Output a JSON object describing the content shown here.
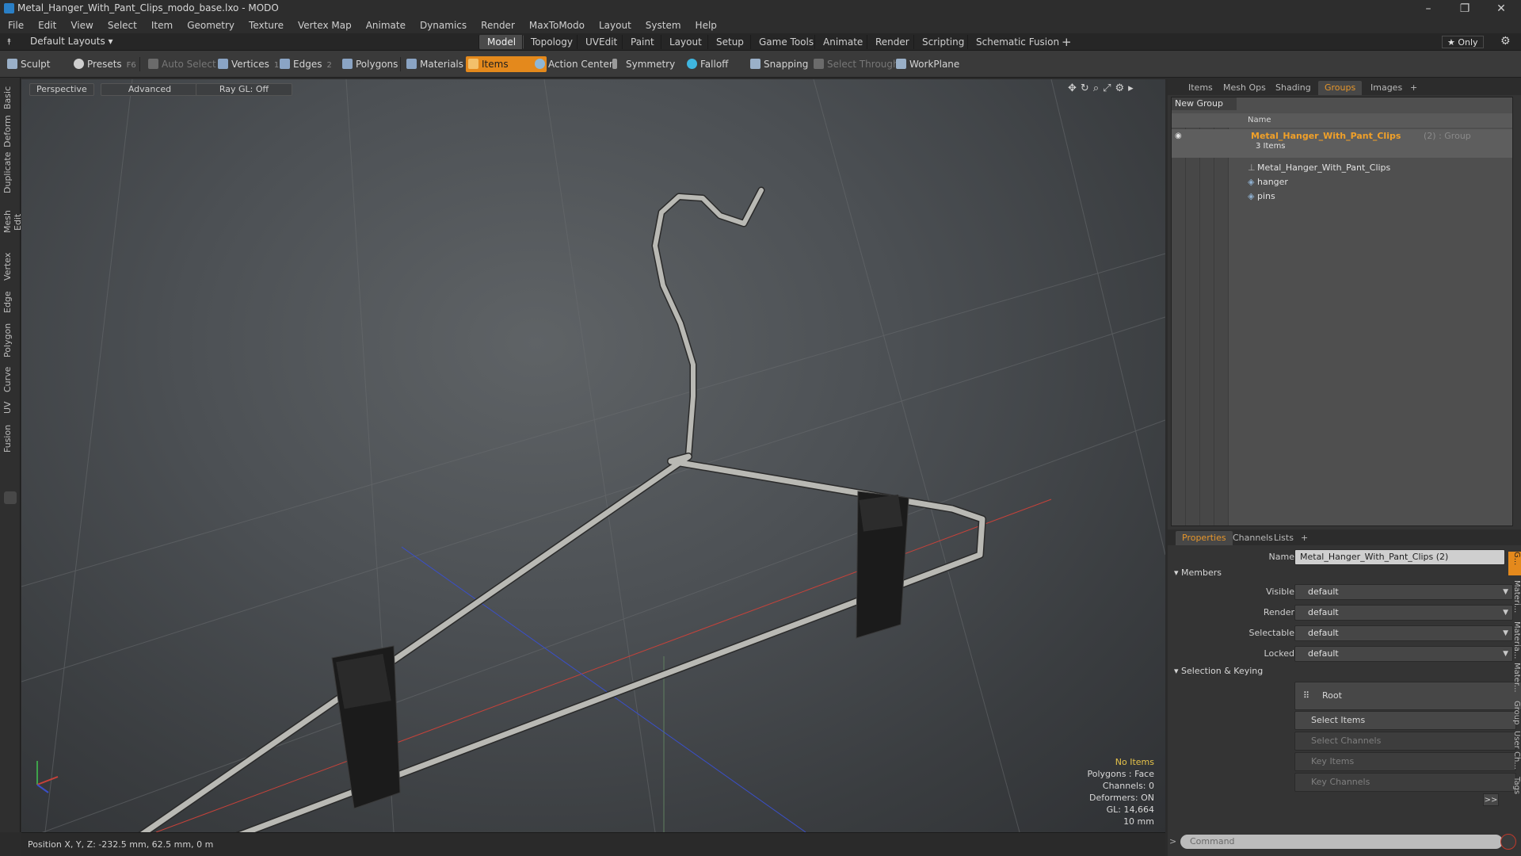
{
  "window": {
    "title": "Metal_Hanger_With_Pant_Clips_modo_base.lxo - MODO",
    "minimize": "–",
    "restore": "❐",
    "close": "✕"
  },
  "menu": [
    "File",
    "Edit",
    "View",
    "Select",
    "Item",
    "Geometry",
    "Texture",
    "Vertex Map",
    "Animate",
    "Dynamics",
    "Render",
    "MaxToModo",
    "Layout",
    "System",
    "Help"
  ],
  "layouts": {
    "dropdown": "Default Layouts ▾",
    "tabs": [
      "Model",
      "Topology",
      "UVEdit",
      "Paint",
      "Layout",
      "Setup",
      "Game Tools",
      "Animate",
      "Render",
      "Scripting",
      "Schematic Fusion"
    ],
    "active": "Model",
    "plus": "+",
    "only": "★  Only",
    "gear": "⚙"
  },
  "toolbar": {
    "sculpt": "Sculpt",
    "presets": "Presets",
    "presets_key": "F6",
    "auto_select": "Auto Select",
    "vertices": "Vertices",
    "vertices_count": "1",
    "edges": "Edges",
    "edges_count": "2",
    "polygons": "Polygons",
    "materials": "Materials",
    "items": "Items",
    "action_center": "Action Center",
    "symmetry": "Symmetry",
    "falloff": "Falloff",
    "snapping": "Snapping",
    "select_through": "Select Through",
    "workplane": "WorkPlane"
  },
  "left_tabs": [
    "Basic",
    "Deform",
    "Duplicate",
    "Mesh Edit",
    "Vertex",
    "Edge",
    "Polygon",
    "Curve",
    "UV",
    "Fusion"
  ],
  "viewport": {
    "perspective": "Perspective",
    "advanced": "Advanced",
    "raygl": "Ray GL: Off",
    "info": {
      "items": "No Items",
      "polygons": "Polygons : Face",
      "channels": "Channels: 0",
      "deformers": "Deformers: ON",
      "gl": "GL: 14,664",
      "scale": "10 mm"
    },
    "colors": {
      "wire": "#b9b9b4",
      "clip": "#1c1c1c",
      "x_axis": "#c8423a",
      "z_axis": "#3a4fc8"
    }
  },
  "status": {
    "position": "Position X, Y, Z:  -232.5 mm, 62.5 mm, 0 m"
  },
  "top_panel": {
    "tabs": [
      "Items",
      "Mesh Ops",
      "Shading",
      "Groups",
      "Images",
      "+"
    ],
    "active": "Groups",
    "new_group": "New Group",
    "name_header": "Name",
    "group_name": "Metal_Hanger_With_Pant_Clips",
    "group_suffix": "(2) : Group",
    "group_count": "3 Items",
    "children": [
      "Metal_Hanger_With_Pant_Clips",
      "hanger",
      "pins"
    ]
  },
  "properties": {
    "tabs": [
      "Properties",
      "Channels",
      "Lists",
      "+"
    ],
    "active": "Properties",
    "name_label": "Name",
    "name_value": "Metal_Hanger_With_Pant_Clips (2)",
    "members_title": "Members",
    "visible_label": "Visible",
    "visible_value": "default",
    "render_label": "Render",
    "render_value": "default",
    "selectable_label": "Selectable",
    "selectable_value": "default",
    "locked_label": "Locked",
    "locked_value": "default",
    "keying_title": "Selection & Keying",
    "root": "Root",
    "select_items": "Select Items",
    "select_channels": "Select Channels",
    "key_items": "Key Items",
    "key_channels": "Key Channels",
    "more": ">>",
    "side_tabs": [
      "G...",
      "Materi...",
      "Materia...",
      "Mater...",
      "Group",
      "User Ch...",
      "Tags"
    ],
    "command_placeholder": "Command"
  }
}
